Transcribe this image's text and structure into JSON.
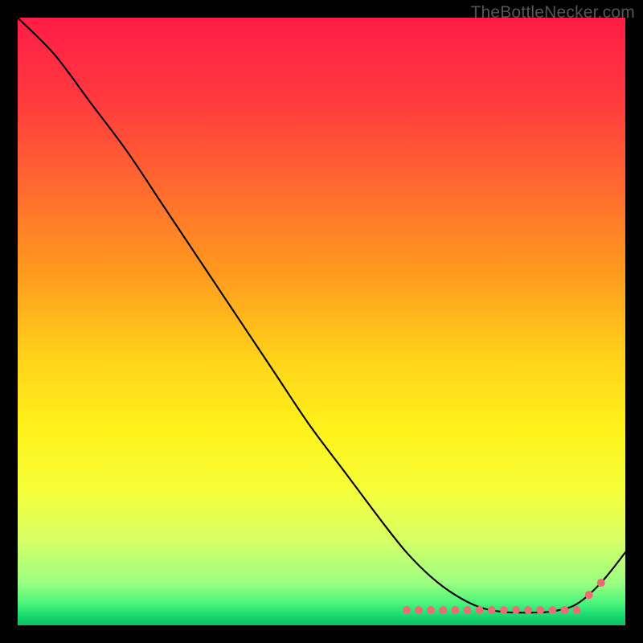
{
  "brand": "TheBottleNecker.com",
  "gradient": {
    "stops": [
      {
        "offset": 0.0,
        "color": "#ff1c46"
      },
      {
        "offset": 0.14,
        "color": "#ff3b3e"
      },
      {
        "offset": 0.28,
        "color": "#ff6a2f"
      },
      {
        "offset": 0.42,
        "color": "#ff9a1e"
      },
      {
        "offset": 0.56,
        "color": "#ffd21a"
      },
      {
        "offset": 0.68,
        "color": "#fff21a"
      },
      {
        "offset": 0.78,
        "color": "#f4ff3a"
      },
      {
        "offset": 0.86,
        "color": "#d6ff66"
      },
      {
        "offset": 0.93,
        "color": "#9cff82"
      },
      {
        "offset": 0.965,
        "color": "#46f57a"
      },
      {
        "offset": 0.985,
        "color": "#17d86f"
      },
      {
        "offset": 1.0,
        "color": "#0fbf63"
      }
    ]
  },
  "chart_data": {
    "type": "line",
    "title": "",
    "xlabel": "",
    "ylabel": "",
    "xlim": [
      0,
      100
    ],
    "ylim": [
      0,
      100
    ],
    "x": [
      0,
      6,
      12,
      18,
      24,
      30,
      36,
      42,
      48,
      54,
      60,
      64,
      68,
      72,
      76,
      80,
      84,
      88,
      92,
      96,
      100
    ],
    "y": [
      100,
      94,
      86,
      78,
      69,
      60,
      51,
      42,
      33,
      25,
      17,
      12,
      8,
      5,
      3,
      2.2,
      2.1,
      2.3,
      3.5,
      7,
      12
    ],
    "marker_band": {
      "x_start": 64,
      "x_end": 92,
      "y": 2.5
    },
    "extra_markers": [
      {
        "x": 94,
        "y": 5.0
      },
      {
        "x": 96,
        "y": 7.0
      }
    ],
    "marker_color": "#ed6b74",
    "marker_radius": 5,
    "marker_step": 2
  }
}
